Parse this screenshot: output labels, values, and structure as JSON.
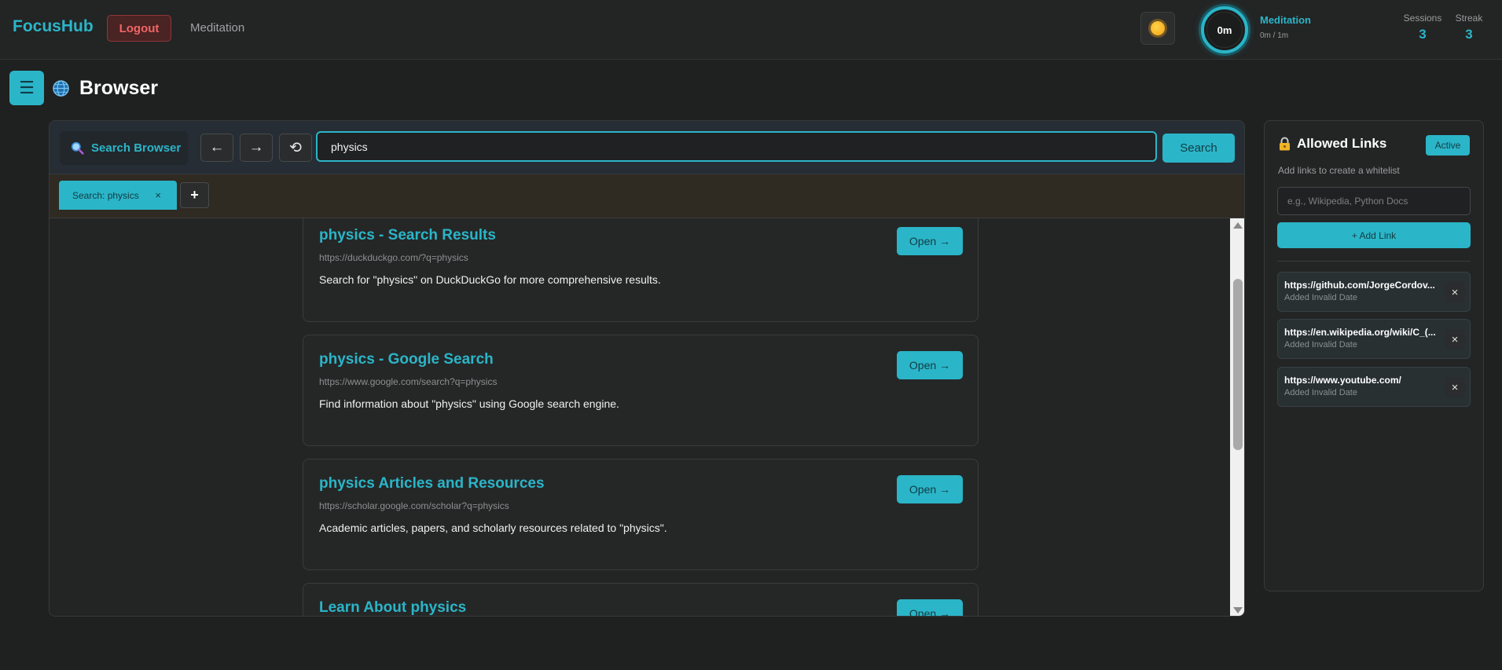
{
  "app": {
    "brand": "FocusHub",
    "logout_label": "Logout",
    "nav_meditation": "Meditation"
  },
  "timer": {
    "display": "0m",
    "title": "Meditation",
    "progress": "0m / 1m"
  },
  "stats": {
    "sessions_label": "Sessions",
    "sessions_value": "3",
    "streak_label": "Streak",
    "streak_value": "3"
  },
  "page": {
    "title": "Browser"
  },
  "browser": {
    "search_browser_label": "Search Browser",
    "back_label": "←",
    "forward_label": "→",
    "reload_label": "⟲",
    "url_value": "physics",
    "search_label": "Search",
    "tabs": [
      {
        "label": "Search: physics",
        "close": "×"
      }
    ],
    "new_tab_label": "+",
    "results": [
      {
        "title": "physics - Search Results",
        "url": "https://duckduckgo.com/?q=physics",
        "description": "Search for \"physics\" on DuckDuckGo for more comprehensive results.",
        "open_label": "Open →"
      },
      {
        "title": "physics - Google Search",
        "url": "https://www.google.com/search?q=physics",
        "description": "Find information about \"physics\" using Google search engine.",
        "open_label": "Open →"
      },
      {
        "title": "physics Articles and Resources",
        "url": "https://scholar.google.com/scholar?q=physics",
        "description": "Academic articles, papers, and scholarly resources related to \"physics\".",
        "open_label": "Open →"
      },
      {
        "title": "Learn About physics",
        "url": "",
        "description": "",
        "open_label": "Open →"
      }
    ]
  },
  "allowed_links": {
    "title": "Allowed Links",
    "badge": "Active",
    "subtitle": "Add links to create a whitelist",
    "input_placeholder": "e.g., Wikipedia, Python Docs",
    "add_label": "+ Add Link",
    "items": [
      {
        "url": "https://github.com/JorgeCordov...",
        "date": "Added Invalid Date",
        "remove": "×"
      },
      {
        "url": "https://en.wikipedia.org/wiki/C_(...",
        "date": "Added Invalid Date",
        "remove": "×"
      },
      {
        "url": "https://www.youtube.com/",
        "date": "Added Invalid Date",
        "remove": "×"
      }
    ]
  },
  "colors": {
    "accent": "#2bb5c8",
    "background": "#1f2020",
    "danger": "#f06565"
  },
  "icons": {
    "theme": "sun-icon",
    "menu": "hamburger-icon",
    "page": "globe-icon",
    "search": "magnifier-icon",
    "allowed": "lock-icon"
  }
}
